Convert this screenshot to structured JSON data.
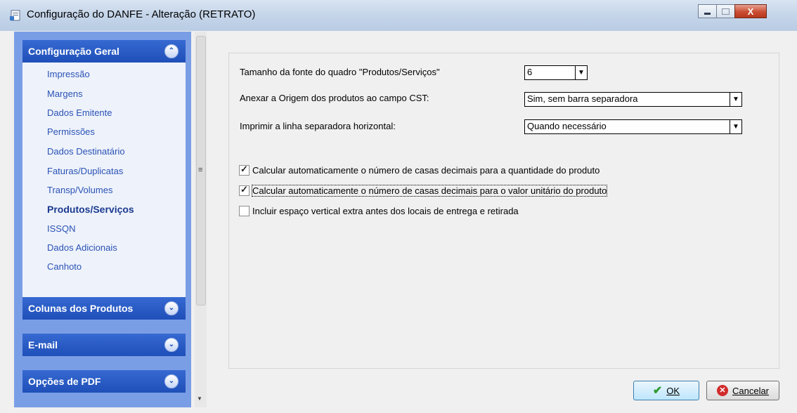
{
  "window": {
    "title": "Configuração do DANFE - Alteração  (RETRATO)",
    "icon": "document-icon"
  },
  "sidebar": {
    "groups": [
      {
        "title": "Configuração Geral",
        "expanded": true,
        "items": [
          {
            "label": "Impressão",
            "active": false
          },
          {
            "label": "Margens",
            "active": false
          },
          {
            "label": "Dados Emitente",
            "active": false
          },
          {
            "label": "Permissões",
            "active": false
          },
          {
            "label": "Dados Destinatário",
            "active": false
          },
          {
            "label": "Faturas/Duplicatas",
            "active": false
          },
          {
            "label": "Transp/Volumes",
            "active": false
          },
          {
            "label": "Produtos/Serviços",
            "active": true
          },
          {
            "label": "ISSQN",
            "active": false
          },
          {
            "label": "Dados Adicionais",
            "active": false
          },
          {
            "label": "Canhoto",
            "active": false
          }
        ]
      },
      {
        "title": "Colunas dos Produtos",
        "expanded": false
      },
      {
        "title": "E-mail",
        "expanded": false
      },
      {
        "title": "Opções de PDF",
        "expanded": false
      }
    ]
  },
  "form": {
    "font_size": {
      "label": "Tamanho da fonte do quadro \"Produtos/Serviços\"",
      "value": "6"
    },
    "origem": {
      "label": "Anexar a Origem dos produtos ao campo CST:",
      "value": "Sim, sem barra separadora"
    },
    "linha_sep": {
      "label": "Imprimir a linha separadora horizontal:",
      "value": "Quando necessário"
    },
    "checkboxes": [
      {
        "label": "Calcular automaticamente o número de casas decimais para a quantidade do produto",
        "checked": true
      },
      {
        "label": "Calcular automaticamente o número de casas decimais para o valor unitário do produto",
        "checked": true
      },
      {
        "label": "Incluir espaço vertical extra antes dos locais de entrega e retirada",
        "checked": false
      }
    ]
  },
  "buttons": {
    "ok_label": "OK",
    "cancel_label": "Cancelar"
  },
  "colors": {
    "sidebar_bg": "#7a9ee6",
    "group_header": "#2459c4",
    "nav_link": "#2a53b5"
  }
}
